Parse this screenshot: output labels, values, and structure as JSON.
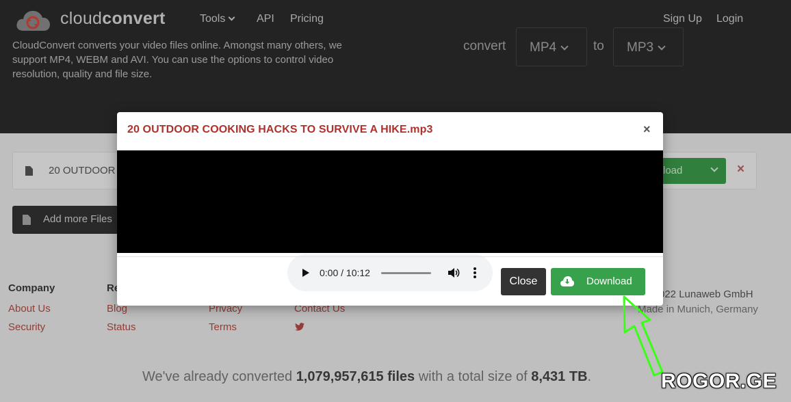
{
  "brand": {
    "name_light": "cloud",
    "name_bold": "convert",
    "logo_color": "#d9463b"
  },
  "nav": {
    "tools": "Tools",
    "api": "API",
    "pricing": "Pricing",
    "signup": "Sign Up",
    "login": "Login"
  },
  "hero": {
    "description": "CloudConvert converts your video files online. Amongst many others, we support MP4, WEBM and AVI. You can use the options to control video resolution, quality and file size.",
    "convert_label": "convert",
    "from_format": "MP4",
    "to_label": "to",
    "to_format": "MP3"
  },
  "file_row": {
    "name": "20 OUTDOOR",
    "download_label": "load",
    "remove": "×"
  },
  "add_files": "Add more Files",
  "footer": {
    "company": {
      "title": "Company",
      "links": [
        "About Us",
        "Security"
      ]
    },
    "resources": {
      "title": "Re",
      "links": [
        "Blog",
        "Status"
      ]
    },
    "legal": {
      "links": [
        "Privacy",
        "Terms"
      ]
    },
    "contact": {
      "links": [
        "Contact Us"
      ]
    },
    "copyright": "022 Lunaweb GmbH",
    "location": "Made in Munich, Germany"
  },
  "stats": {
    "prefix": "We've already converted ",
    "files": "1,079,957,615 files",
    "middle": " with a total size of ",
    "size": "8,431 TB",
    "suffix": "."
  },
  "modal": {
    "title": "20 OUTDOOR COOKING HACKS TO SURVIVE A HIKE.mp3",
    "close_x": "×",
    "audio": {
      "time": "0:00 / 10:12",
      "progress": 0
    },
    "close_button": "Close",
    "download_button": "Download"
  },
  "colors": {
    "title_red": "#b0302b",
    "download_green": "#37a24b",
    "annotation_arrow": "#39ff14"
  },
  "watermark": "ROGOR.GE"
}
